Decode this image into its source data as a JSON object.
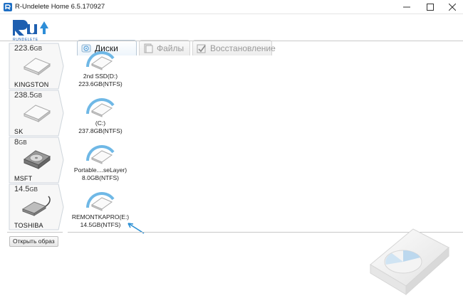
{
  "window": {
    "title": "R-Undelete Home 6.5.170927",
    "minimize_icon": "minimize-icon",
    "maximize_icon": "maximize-icon",
    "close_icon": "close-icon"
  },
  "logo": {
    "text": "RUNDELETE"
  },
  "tabs": [
    {
      "label": "Диски",
      "icon": "disk-tab-icon",
      "active": true
    },
    {
      "label": "Файлы",
      "icon": "files-tab-icon",
      "active": false
    },
    {
      "label": "Восстановление",
      "icon": "restore-tab-icon",
      "active": false
    }
  ],
  "disks": [
    {
      "size": "223.6",
      "unit": "GB",
      "name": "KINGSTON",
      "type": "ssd",
      "partition": {
        "line1": "2nd SSD(D:)",
        "line2": "223.6GB(NTFS)"
      }
    },
    {
      "size": "238.5",
      "unit": "GB",
      "name": "SK",
      "type": "ssd",
      "partition": {
        "line1": "(C:)",
        "line2": "237.8GB(NTFS)"
      }
    },
    {
      "size": "8",
      "unit": "GB",
      "name": "MSFT",
      "type": "hdd",
      "partition": {
        "line1": "Portable....seLayer)",
        "line2": "8.0GB(NTFS)"
      }
    },
    {
      "size": "14.5",
      "unit": "GB",
      "name": "TOSHIBA",
      "type": "usb",
      "partition": {
        "line1": "REMONTKAPRO(E:)",
        "line2": "14.5GB(NTFS)"
      }
    }
  ],
  "buttons": {
    "open_image": "Открыть образ"
  },
  "colors": {
    "accent": "#1e8fd6",
    "arc": "#6fb8e6",
    "arrow": "#2a8fd4"
  }
}
